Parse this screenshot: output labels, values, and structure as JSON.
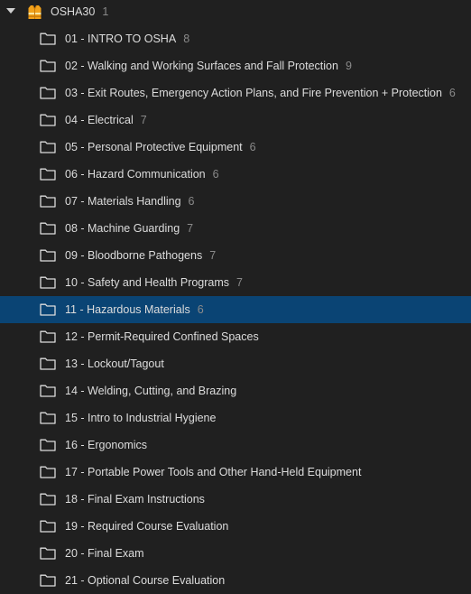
{
  "root": {
    "icon": "safety-vest-icon",
    "label": "OSHA30",
    "count": "1"
  },
  "folders": [
    {
      "label": "01 - INTRO TO OSHA",
      "count": "8"
    },
    {
      "label": "02 - Walking and Working Surfaces and Fall Protection",
      "count": "9"
    },
    {
      "label": "03 - Exit Routes, Emergency Action Plans, and Fire Prevention + Protection",
      "count": "6"
    },
    {
      "label": "04 - Electrical",
      "count": "7"
    },
    {
      "label": "05 - Personal Protective Equipment",
      "count": "6"
    },
    {
      "label": "06 - Hazard Communication",
      "count": "6"
    },
    {
      "label": "07 - Materials Handling",
      "count": "6"
    },
    {
      "label": "08 - Machine Guarding",
      "count": "7"
    },
    {
      "label": "09 - Bloodborne Pathogens",
      "count": "7"
    },
    {
      "label": "10 - Safety and Health Programs",
      "count": "7"
    },
    {
      "label": "11 - Hazardous Materials",
      "count": "6",
      "selected": true
    },
    {
      "label": "12 - Permit-Required Confined Spaces",
      "count": ""
    },
    {
      "label": "13 - Lockout/Tagout",
      "count": ""
    },
    {
      "label": "14 - Welding, Cutting, and Brazing",
      "count": ""
    },
    {
      "label": "15 - Intro to Industrial Hygiene",
      "count": ""
    },
    {
      "label": "16 - Ergonomics",
      "count": ""
    },
    {
      "label": "17 - Portable Power Tools and Other Hand-Held Equipment",
      "count": ""
    },
    {
      "label": "18 - Final Exam Instructions",
      "count": ""
    },
    {
      "label": "19 - Required Course Evaluation",
      "count": ""
    },
    {
      "label": "20 - Final Exam",
      "count": ""
    },
    {
      "label": "21 - Optional Course Evaluation",
      "count": ""
    }
  ],
  "colors": {
    "background": "#202020",
    "selected": "#0a4474",
    "text": "#dcdcdc",
    "count": "#8a8a8a",
    "vest": "#f2a21b"
  }
}
